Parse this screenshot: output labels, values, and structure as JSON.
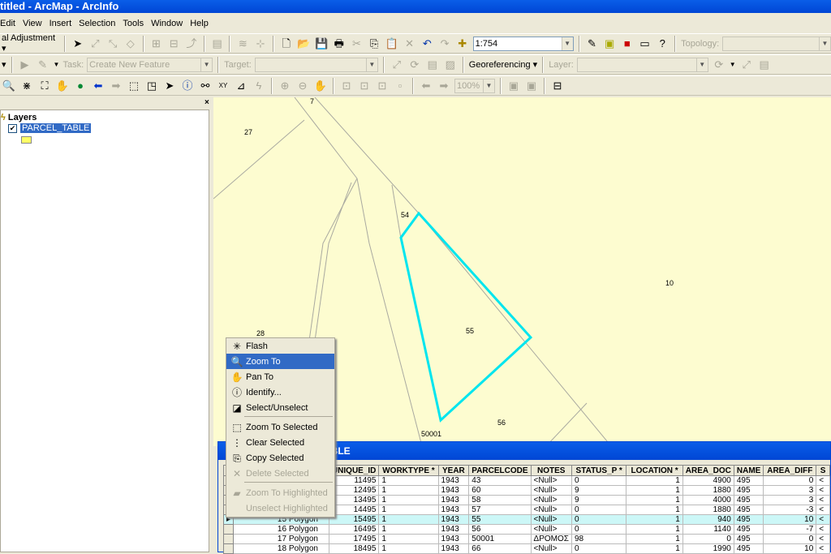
{
  "window": {
    "title": "titled - ArcMap - ArcInfo"
  },
  "menubar": [
    "Edit",
    "View",
    "Insert",
    "Selection",
    "Tools",
    "Window",
    "Help"
  ],
  "toolbar1": {
    "adjustment_label": "al Adjustment",
    "scale": "1:754",
    "topology_label": "Topology:"
  },
  "toolbar2": {
    "task_label": "Task:",
    "task_value": "Create New Feature",
    "target_label": "Target:",
    "georeferencing": "Georeferencing",
    "layer_label": "Layer:"
  },
  "toolbar3": {
    "zoom_percent": "100%"
  },
  "toc": {
    "root": "Layers",
    "layer": "PARCEL_TABLE",
    "layer_checked": true,
    "symbol_color": "#ffff66"
  },
  "map": {
    "background": "#fdfcd0",
    "selection_color": "#00e5ee",
    "labels": [
      {
        "text": "7"
      },
      {
        "text": "27"
      },
      {
        "text": "54"
      },
      {
        "text": "10"
      },
      {
        "text": "55"
      },
      {
        "text": "28"
      },
      {
        "text": "56"
      },
      {
        "text": "50001"
      }
    ]
  },
  "context_menu": {
    "items": [
      {
        "label": "Flash",
        "icon": "flash-icon",
        "enabled": true
      },
      {
        "label": "Zoom To",
        "icon": "zoom-to-icon",
        "enabled": true,
        "highlighted": true
      },
      {
        "label": "Pan To",
        "icon": "pan-hand-icon",
        "enabled": true
      },
      {
        "label": "Identify...",
        "icon": "identify-icon",
        "enabled": true
      },
      {
        "label": "Select/Unselect",
        "icon": "select-icon",
        "enabled": true
      },
      {
        "label": "Zoom To Selected",
        "icon": "zoom-selected-icon",
        "enabled": true
      },
      {
        "label": "Clear Selected",
        "icon": "clear-selected-icon",
        "enabled": true
      },
      {
        "label": "Copy Selected",
        "icon": "copy-icon",
        "enabled": true
      },
      {
        "label": "Delete Selected",
        "icon": "delete-icon",
        "enabled": false
      },
      {
        "label": "Zoom To Highlighted",
        "icon": "zoom-highlighted-icon",
        "enabled": false
      },
      {
        "label": "Unselect Highlighted",
        "icon": "",
        "enabled": false
      }
    ]
  },
  "attribute_table": {
    "title": "ABLE",
    "columns": [
      "",
      "UNIQUE_ID",
      "WORKTYPE *",
      "YEAR",
      "PARCELCODE",
      "NOTES",
      "STATUS_P *",
      "LOCATION *",
      "AREA_DOC",
      "NAME",
      "AREA_DIFF",
      "S"
    ],
    "rows": [
      {
        "fid": "",
        "shape": "",
        "cells": [
          "11495",
          "1",
          "1943",
          "43",
          "<Null>",
          "0",
          "1",
          "4900",
          "495",
          "0",
          "<"
        ]
      },
      {
        "fid": "",
        "shape": "",
        "cells": [
          "12495",
          "1",
          "1943",
          "60",
          "<Null>",
          "9",
          "1",
          "1880",
          "495",
          "3",
          "<"
        ]
      },
      {
        "fid": "",
        "shape": "",
        "cells": [
          "13495",
          "1",
          "1943",
          "58",
          "<Null>",
          "9",
          "1",
          "4000",
          "495",
          "3",
          "<"
        ]
      },
      {
        "fid": "",
        "shape": "",
        "cells": [
          "14495",
          "1",
          "1943",
          "57",
          "<Null>",
          "0",
          "1",
          "1880",
          "495",
          "-3",
          "<"
        ]
      },
      {
        "fid": "15",
        "shape": "Polygon",
        "selected": true,
        "cells": [
          "15495",
          "1",
          "1943",
          "55",
          "<Null>",
          "0",
          "1",
          "940",
          "495",
          "10",
          "<"
        ]
      },
      {
        "fid": "16",
        "shape": "Polygon",
        "cells": [
          "16495",
          "1",
          "1943",
          "56",
          "<Null>",
          "0",
          "1",
          "1140",
          "495",
          "-7",
          "<"
        ]
      },
      {
        "fid": "17",
        "shape": "Polygon",
        "cells": [
          "17495",
          "1",
          "1943",
          "50001",
          "ΔΡΟΜΟΣ",
          "98",
          "1",
          "0",
          "495",
          "0",
          "<"
        ]
      },
      {
        "fid": "18",
        "shape": "Polygon",
        "cells": [
          "18495",
          "1",
          "1943",
          "66",
          "<Null>",
          "0",
          "1",
          "1990",
          "495",
          "10",
          "<"
        ]
      }
    ]
  }
}
